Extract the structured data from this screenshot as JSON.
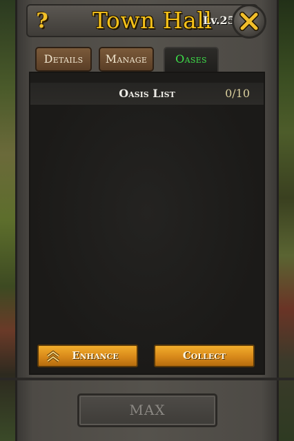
{
  "window": {
    "title": "Town Hall",
    "level": "Lv.25",
    "help_icon": "?"
  },
  "tabs": [
    {
      "label": "Details",
      "active": false
    },
    {
      "label": "Manage",
      "active": false
    },
    {
      "label": "Oases",
      "active": true
    }
  ],
  "oasis_list": {
    "title": "Oasis List",
    "count": "0/10"
  },
  "actions": {
    "enhance_label": "Enhance",
    "collect_label": "Collect",
    "max_label": "MAX"
  },
  "colors": {
    "title_gold": "#f6c21a",
    "active_tab_green": "#3ee04a",
    "button_gold": "#d8891a"
  }
}
